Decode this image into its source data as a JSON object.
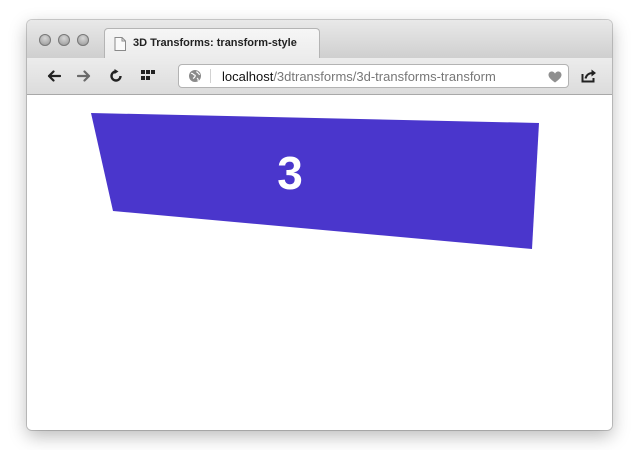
{
  "window": {
    "tab": {
      "title": "3D Transforms: transform-style",
      "icon": "document-icon"
    },
    "toolbar": {
      "back_icon": "back-arrow-icon",
      "forward_icon": "forward-arrow-icon",
      "reload_icon": "reload-icon",
      "topsites_icon": "grid-icon",
      "share_icon": "share-icon"
    },
    "address": {
      "host": "localhost",
      "path": "/3dtransforms/3d-transforms-transform",
      "site_icon": "globe-icon",
      "bookmark_icon": "heart-icon"
    }
  },
  "page": {
    "card": {
      "label": "3",
      "color": "#4a36cc"
    }
  },
  "colors": {
    "card_fill": "#4a36cc",
    "card_text": "#ffffff",
    "url_host": "#111111",
    "url_path": "#777777"
  }
}
